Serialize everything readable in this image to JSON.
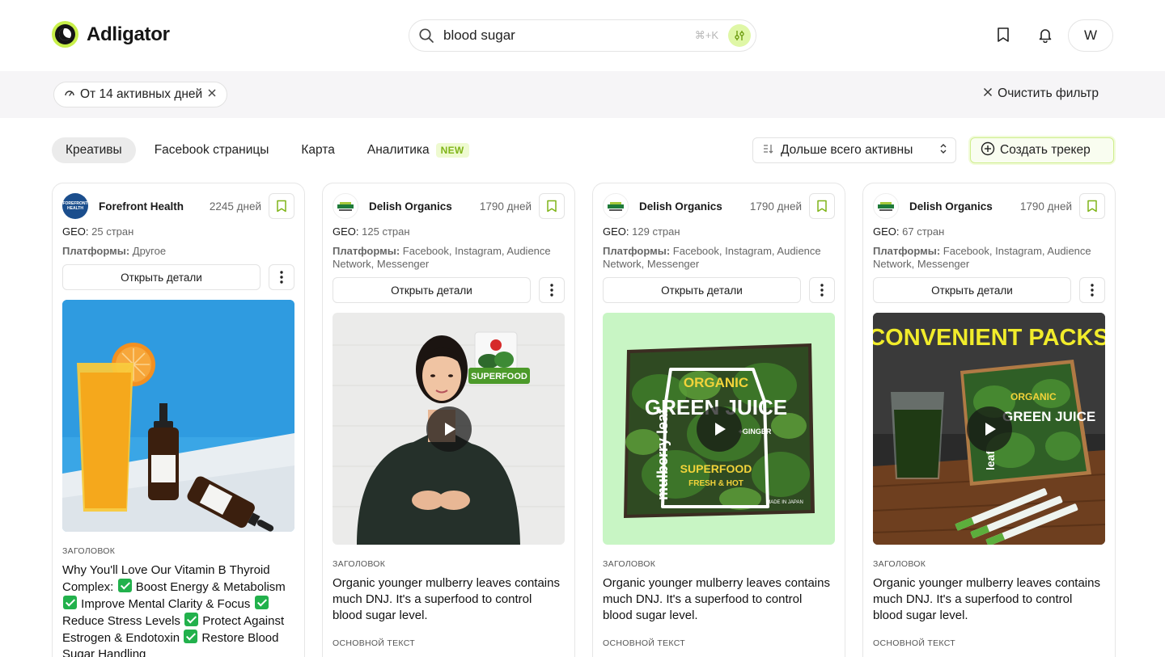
{
  "header": {
    "logo_text": "Adligator",
    "search": {
      "value": "blood sugar",
      "shortcut": "⌘+K"
    },
    "avatar_initial": "W"
  },
  "filters": {
    "active_chip": "От 14 активных дней",
    "clear_label": "Очистить фильтр"
  },
  "tabs": [
    {
      "label": "Креативы",
      "active": true
    },
    {
      "label": "Facebook страницы",
      "active": false
    },
    {
      "label": "Карта",
      "active": false
    },
    {
      "label": "Аналитика",
      "active": false,
      "badge": "NEW"
    }
  ],
  "sort": {
    "label": "Дольше всего активны"
  },
  "create_tracker_label": "Создать трекер",
  "labels": {
    "geo": "GEO:",
    "platforms": "Платформы:",
    "open_details": "Открыть детали",
    "headline_section": "ЗАГОЛОВОК",
    "body_section": "ОСНОВНОЙ ТЕКСТ"
  },
  "cards": [
    {
      "brand": "Forefront Health",
      "brand_logo_text": "FOREFRONT HEALTH",
      "days": "2245 дней",
      "geo": "25 стран",
      "platforms": "Другое",
      "media_type": "image",
      "headline_parts": [
        "Why You'll Love Our Vitamin B Thyroid Complex: ",
        " Boost Energy & Metabolism ",
        " Improve Mental Clarity & Focus ",
        " Reduce Stress Levels ",
        " Protect Against Estrogen & Endotoxin ",
        " Restore Blood Sugar Handling"
      ]
    },
    {
      "brand": "Delish Organics",
      "days": "1790 дней",
      "geo": "125 стран",
      "platforms": "Facebook, Instagram, Audience Network, Messenger",
      "media_type": "video",
      "media_badge": "SUPERFOOD",
      "headline": "Organic younger mulberry leaves contains much DNJ. It's a superfood to control blood sugar level."
    },
    {
      "brand": "Delish Organics",
      "days": "1790 дней",
      "geo": "129 стран",
      "platforms": "Facebook, Instagram, Audience Network, Messenger",
      "media_type": "video",
      "media_text": {
        "top": "ORGANIC",
        "mid": "GREEN JUICE",
        "side": "mulberry leaf",
        "bottom1": "SUPERFOOD",
        "bottom2": "FRESH & HOT",
        "plus": "+GINGER",
        "made": "MADE IN JAPAN"
      },
      "headline": "Organic younger mulberry leaves contains much DNJ. It's a superfood to control blood sugar level."
    },
    {
      "brand": "Delish Organics",
      "days": "1790 дней",
      "geo": "67 стран",
      "platforms": "Facebook, Instagram, Audience Network, Messenger",
      "media_type": "video",
      "media_text": {
        "banner": "CONVENIENT PACKS",
        "box_top": "ORGANIC",
        "box_mid": "GREEN JUICE",
        "side": "leaf"
      },
      "headline": "Organic younger mulberry leaves contains much DNJ. It's a superfood to control blood sugar level."
    }
  ],
  "colors": {
    "accent_lime": "#c8f04a",
    "badge_bg": "#eefad0",
    "badge_text": "#7fb418",
    "filter_band": "#f6f5f7",
    "check_green": "#22b14c"
  }
}
